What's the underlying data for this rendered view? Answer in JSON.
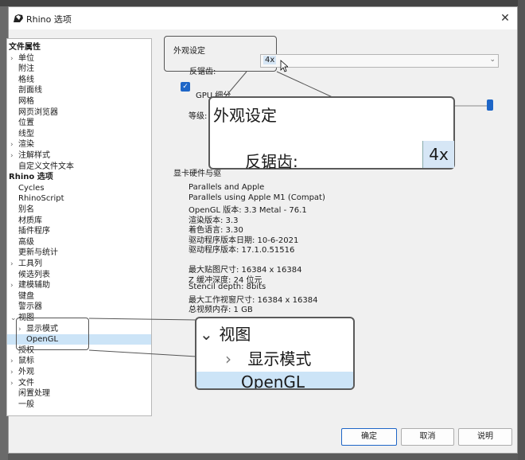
{
  "window": {
    "title": "Rhino 选项",
    "close_glyph": "✕"
  },
  "tree": {
    "items": [
      {
        "label": "文件属性",
        "bold": true,
        "level": 0,
        "arrow": ""
      },
      {
        "label": "单位",
        "level": 1,
        "arrow": "›"
      },
      {
        "label": "附注",
        "level": 1,
        "arrow": ""
      },
      {
        "label": "格线",
        "level": 1,
        "arrow": ""
      },
      {
        "label": "剖面线",
        "level": 1,
        "arrow": ""
      },
      {
        "label": "网格",
        "level": 1,
        "arrow": ""
      },
      {
        "label": "网页浏览器",
        "level": 1,
        "arrow": ""
      },
      {
        "label": "位置",
        "level": 1,
        "arrow": ""
      },
      {
        "label": "线型",
        "level": 1,
        "arrow": ""
      },
      {
        "label": "渲染",
        "level": 1,
        "arrow": "›"
      },
      {
        "label": "注解样式",
        "level": 1,
        "arrow": "›"
      },
      {
        "label": "自定义文件文本",
        "level": 1,
        "arrow": ""
      },
      {
        "label": "Rhino 选项",
        "bold": true,
        "level": 0,
        "arrow": ""
      },
      {
        "label": "Cycles",
        "level": 1,
        "arrow": ""
      },
      {
        "label": "RhinoScript",
        "level": 1,
        "arrow": ""
      },
      {
        "label": "别名",
        "level": 1,
        "arrow": ""
      },
      {
        "label": "材质库",
        "level": 1,
        "arrow": ""
      },
      {
        "label": "插件程序",
        "level": 1,
        "arrow": ""
      },
      {
        "label": "高级",
        "level": 1,
        "arrow": ""
      },
      {
        "label": "更新与统计",
        "level": 1,
        "arrow": ""
      },
      {
        "label": "工具列",
        "level": 1,
        "arrow": "›"
      },
      {
        "label": "候选列表",
        "level": 1,
        "arrow": ""
      },
      {
        "label": "建模辅助",
        "level": 1,
        "arrow": "›"
      },
      {
        "label": "键盘",
        "level": 1,
        "arrow": ""
      },
      {
        "label": "警示器",
        "level": 1,
        "arrow": ""
      },
      {
        "label": "视图",
        "level": 1,
        "arrow": "⌄"
      },
      {
        "label": "显示模式",
        "level": 2,
        "arrow": "›"
      },
      {
        "label": "OpenGL",
        "level": 2,
        "arrow": "",
        "selected": true
      },
      {
        "label": "授权",
        "level": 1,
        "arrow": ""
      },
      {
        "label": "鼠标",
        "level": 1,
        "arrow": "›"
      },
      {
        "label": "外观",
        "level": 1,
        "arrow": "›"
      },
      {
        "label": "文件",
        "level": 1,
        "arrow": "›"
      },
      {
        "label": "闲置处理",
        "level": 1,
        "arrow": ""
      },
      {
        "label": "一般",
        "level": 1,
        "arrow": ""
      }
    ]
  },
  "appearance": {
    "group_title": "外观设定",
    "antialias_label": "反锯齿:",
    "antialias_value": "4x",
    "gpu_label": "GPU 细分",
    "gpu_checked": true,
    "level_label": "等级:"
  },
  "hardware": {
    "section_title": "显卡硬件与驱",
    "lines_a": [
      "Parallels and Apple",
      "Parallels using Apple M1 (Compat)",
      "OpenGL 版本: 3.3 Metal - 76.1",
      "渲染版本: 3.3",
      "着色语言: 3.30",
      "驱动程序版本日期: 10-6-2021",
      "驱动程序版本: 17.1.0.51516"
    ],
    "lines_b": [
      "最大贴图尺寸: 16384 x 16384",
      "Z 缓冲深度: 24 位元",
      "Stencil depth: 8bits",
      "最大工作视窗尺寸: 16384 x 16384",
      "总视频内存: 1 GB"
    ]
  },
  "zoom_tree": {
    "parent": "视图",
    "parent_arrow": "⌄",
    "child1": "显示模式",
    "child1_arrow": "›",
    "child2": "OpenGL"
  },
  "buttons": {
    "ok": "确定",
    "cancel": "取消",
    "help": "说明"
  },
  "colors": {
    "accent": "#1e66c7",
    "selection": "#cce4f7"
  }
}
